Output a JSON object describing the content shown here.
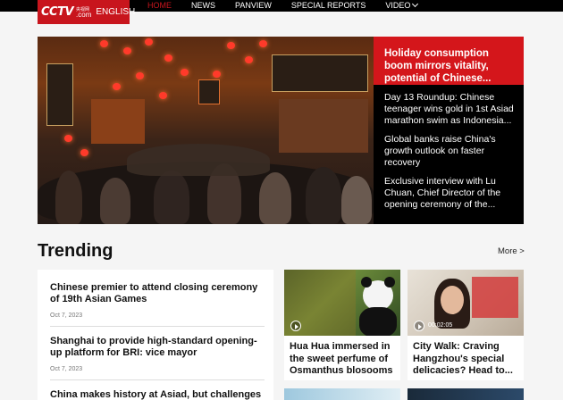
{
  "nav": {
    "logo_mark": "CCTV",
    "logo_cn": "央视网",
    "logo_com": ".com",
    "logo_text": "ENGLISH",
    "items": [
      {
        "label": "HOME",
        "active": true
      },
      {
        "label": "NEWS",
        "active": false
      },
      {
        "label": "PANVIEW",
        "active": false
      },
      {
        "label": "SPECIAL REPORTS",
        "active": false
      },
      {
        "label": "VIDEO",
        "active": false
      }
    ]
  },
  "hero": {
    "lead": "Holiday consumption boom mirrors vitality, potential of Chinese...",
    "items": [
      "Day 13 Roundup: Chinese teenager wins gold in 1st Asiad marathon swim as Indonesia...",
      "Global banks raise China's growth outlook on faster recovery",
      "Exclusive interview with Lu Chuan, Chief Director of the opening ceremony of the..."
    ]
  },
  "trending": {
    "title": "Trending",
    "more": "More >",
    "list": [
      {
        "title": "Chinese premier to attend closing ceremony of 19th Asian Games",
        "date": "Oct 7, 2023"
      },
      {
        "title": "Shanghai to provide high-standard opening-up platform for BRI: vice mayor",
        "date": "Oct 7, 2023"
      },
      {
        "title": "China makes history at Asiad, but challenges",
        "date": ""
      }
    ],
    "cards": [
      {
        "title": "Hua Hua immersed in the sweet perfume of Osmanthus blosooms",
        "duration": ""
      },
      {
        "title": "City Walk: Craving Hangzhou's special delicacies? Head to...",
        "duration": "00:02:05"
      }
    ]
  },
  "colors": {
    "brand_red": "#c8151d",
    "nav_bg": "#000000",
    "hero_red": "#d4161b"
  },
  "icons": {
    "play": "play-icon",
    "dropdown": "chevron-down-icon"
  }
}
